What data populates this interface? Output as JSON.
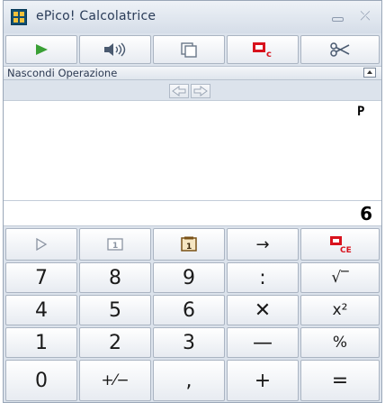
{
  "window": {
    "title": "ePico! Calcolatrice",
    "minimize_icon": "minimize-icon",
    "close_icon": "close-icon",
    "close_glyph": "⤫"
  },
  "toolbar": [
    {
      "name": "play-icon",
      "color": "#3aa035"
    },
    {
      "name": "speaker-icon",
      "color": "#4a5a70"
    },
    {
      "name": "copy-icon",
      "color": "#6a7788"
    },
    {
      "name": "clear-history-icon",
      "color": "#d8121d",
      "label": "c"
    },
    {
      "name": "scissors-icon",
      "color": "#4a5a70"
    }
  ],
  "operation_panel": {
    "label": "Nascondi Operazione",
    "collapse_icon": "triangle-up-icon"
  },
  "history": {
    "marker": "P",
    "entries": []
  },
  "display": {
    "value": "6"
  },
  "keypad": {
    "memory_row": [
      {
        "name": "play-outline-key",
        "glyph": "▷",
        "color": "#8a93a1"
      },
      {
        "name": "memory-recall-key",
        "glyph": "1",
        "color": "#8a93a1"
      },
      {
        "name": "memory-store-key",
        "glyph": "1",
        "color": "#7a5218"
      },
      {
        "name": "arrow-right-key",
        "glyph": "→",
        "color": "#111111"
      },
      {
        "name": "clear-entry-key",
        "glyph": "CE",
        "color": "#d8121d"
      }
    ],
    "rows": [
      [
        {
          "name": "key-7",
          "label": "7"
        },
        {
          "name": "key-8",
          "label": "8"
        },
        {
          "name": "key-9",
          "label": "9"
        },
        {
          "name": "key-divide",
          "label": ":"
        },
        {
          "name": "key-sqrt",
          "label": "√‾"
        }
      ],
      [
        {
          "name": "key-4",
          "label": "4"
        },
        {
          "name": "key-5",
          "label": "5"
        },
        {
          "name": "key-6",
          "label": "6"
        },
        {
          "name": "key-multiply",
          "label": "✕"
        },
        {
          "name": "key-square",
          "label": "x²"
        }
      ],
      [
        {
          "name": "key-1",
          "label": "1"
        },
        {
          "name": "key-2",
          "label": "2"
        },
        {
          "name": "key-3",
          "label": "3"
        },
        {
          "name": "key-minus",
          "label": "—"
        },
        {
          "name": "key-percent",
          "label": "%"
        }
      ],
      [
        {
          "name": "key-0",
          "label": "0"
        },
        {
          "name": "key-sign",
          "label": "+⁄−"
        },
        {
          "name": "key-comma",
          "label": ","
        },
        {
          "name": "key-plus",
          "label": "+"
        },
        {
          "name": "key-equals",
          "label": "="
        }
      ]
    ]
  }
}
